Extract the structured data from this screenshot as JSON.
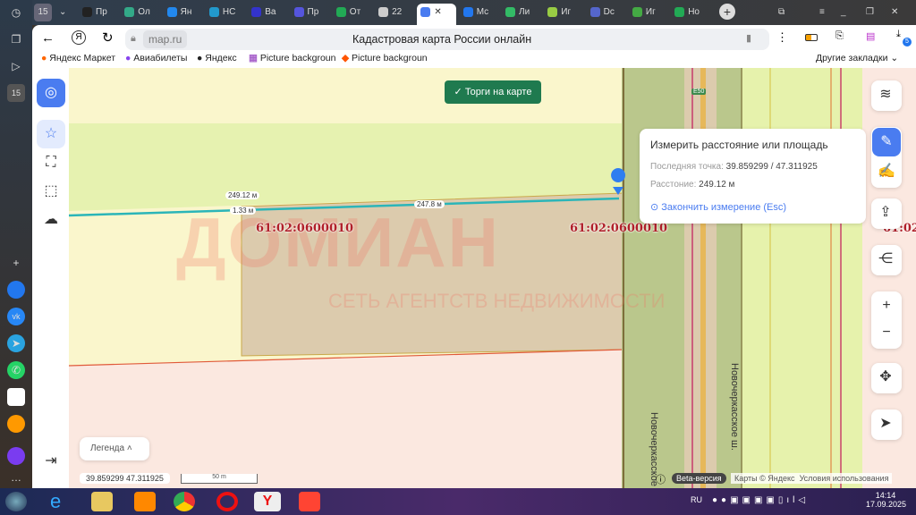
{
  "left_sidebar": {
    "badge": "15"
  },
  "tabs": [
    {
      "label": "Пр",
      "color": "#222"
    },
    {
      "label": "Ол",
      "color": "#3a8"
    },
    {
      "label": "Ян",
      "color": "#28e"
    },
    {
      "label": "НС",
      "color": "#29c"
    },
    {
      "label": "Ва",
      "color": "#33c"
    },
    {
      "label": "Пр",
      "color": "#55d"
    },
    {
      "label": "От",
      "color": "#2a5"
    },
    {
      "label": "22",
      "color": "#ccc"
    },
    {
      "label": "",
      "color": "#4a7cf0",
      "active": true
    },
    {
      "label": "Мс",
      "color": "#27e"
    },
    {
      "label": "Ли",
      "color": "#3b6"
    },
    {
      "label": "Иг",
      "color": "#9c4"
    },
    {
      "label": "Dc",
      "color": "#56c"
    },
    {
      "label": "Иг",
      "color": "#4a4"
    },
    {
      "label": "Но",
      "color": "#2a5"
    }
  ],
  "address": {
    "url": "map.ru",
    "title": "Кадастровая карта России онлайн"
  },
  "extensions": {
    "downloads_badge": "5"
  },
  "bookmarks": [
    "Яндекс Маркет",
    "Авиабилеты",
    "Яндекс",
    "Picture backgroun",
    "Picture backgroun"
  ],
  "other_bookmarks": "Другие закладки",
  "map": {
    "auction_button": "Торги на карте",
    "road_label": "E50",
    "street_label": "Новочеркасское ш.",
    "cadastral_labels": [
      "61:02:0600010",
      "61:02:0600010",
      "61:02"
    ],
    "measure_labels": {
      "total": "249.12 м",
      "segment1": "1.33 м",
      "segment2": "247.8 м"
    },
    "watermark": {
      "brand": "ДОМИАН",
      "tagline": "СЕТЬ АГЕНТСТВ НЕДВИЖИМОСТИ"
    },
    "measure_panel": {
      "title": "Измерить расстояние или площадь",
      "last_point_label": "Последняя точка:",
      "last_point_value": "39.859299 / 47.311925",
      "distance_label": "Расстоние:",
      "distance_value": "249.12 м",
      "finish": "Закончить измерение (Esc)"
    },
    "legend": "Легенда",
    "coords": "39.859299  47.311925",
    "scale": "50 m",
    "beta": "Beta-версия",
    "attribution": "Карты © Яндекс",
    "terms": "Условия использования"
  },
  "taskbar": {
    "lang": "RU",
    "time": "14:14",
    "date": "17.09.2025"
  },
  "colors": {
    "accent": "#4a7cf0",
    "measure_line": "#2bb5b8",
    "cadastral": "#b0202a",
    "auction_green": "#1f7a4f"
  }
}
